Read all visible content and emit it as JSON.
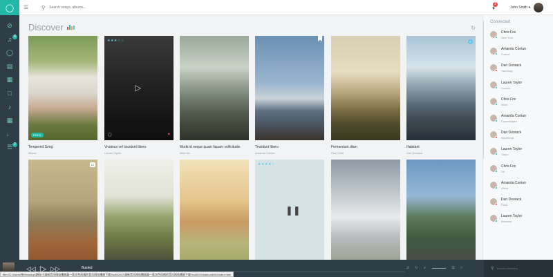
{
  "header": {
    "search_placeholder": "Search songs, albums...",
    "notification_count": "2",
    "user_name": "John Smith ▾"
  },
  "main": {
    "title": "Discover",
    "cards": [
      {
        "title": "Tempered Song",
        "artist": "Miaow",
        "badge": "ROCK"
      },
      {
        "title": "Vivamus vel tincidunt libero",
        "artist": "Lauren Taylor"
      },
      {
        "title": "Morbi id neque quam liquam sollicitudin",
        "artist": "Mike Mo"
      },
      {
        "title": "Tincidunt libero",
        "artist": "Amanda Conlan"
      },
      {
        "title": "Fermentum diam",
        "artist": "Paul Crisil"
      },
      {
        "title": "Habitant",
        "artist": "Dan Doorack",
        "badge": "6"
      },
      {
        "title": "",
        "artist": "",
        "badge": "12"
      },
      {
        "title": "",
        "artist": ""
      },
      {
        "title": "",
        "artist": ""
      },
      {
        "title": "",
        "artist": ""
      },
      {
        "title": "",
        "artist": ""
      },
      {
        "title": "",
        "artist": ""
      }
    ]
  },
  "sidebar": {
    "heading": "Connected",
    "contacts": [
      {
        "name": "Chris Fox",
        "city": "New York",
        "status": "#23b7a8"
      },
      {
        "name": "Amanda Conlan",
        "city": "France",
        "status": "#23b7a8"
      },
      {
        "name": "Dan Doorack",
        "city": "Hamburg",
        "status": "#e54848"
      },
      {
        "name": "Lauren Taylor",
        "city": "London",
        "status": "#23b7a8"
      },
      {
        "name": "Chris Fox",
        "city": "Milan",
        "status": "#23b7a8"
      },
      {
        "name": "Amanda Conlan",
        "city": "Copenhagen",
        "status": "#23b7a8"
      },
      {
        "name": "Dan Doorack",
        "city": "Barcelona",
        "status": "#e54848"
      },
      {
        "name": "Lauren Taylor",
        "city": "Tokyo",
        "status": "#23b7a8"
      },
      {
        "name": "Chris Fox",
        "city": "UK",
        "status": "#23b7a8"
      },
      {
        "name": "Amanda Conlan",
        "city": "Africa",
        "status": "#23b7a8"
      },
      {
        "name": "Dan Doorack",
        "city": "Paris",
        "status": "#e54848"
      },
      {
        "name": "Lauren Taylor",
        "city": "Brussels",
        "status": "#23b7a8"
      }
    ]
  },
  "player": {
    "song": "Busted",
    "search_placeholder": "Search members"
  },
  "status_url": "file:///C:/Users/奈/Desktop/源码/小清新音乐网站播放器一款次色风格的音乐网站播放下载%u3002/小清新音乐网站播放器一款次色风格的音乐网站播放下载%u3002/chaihua3464/index.html"
}
